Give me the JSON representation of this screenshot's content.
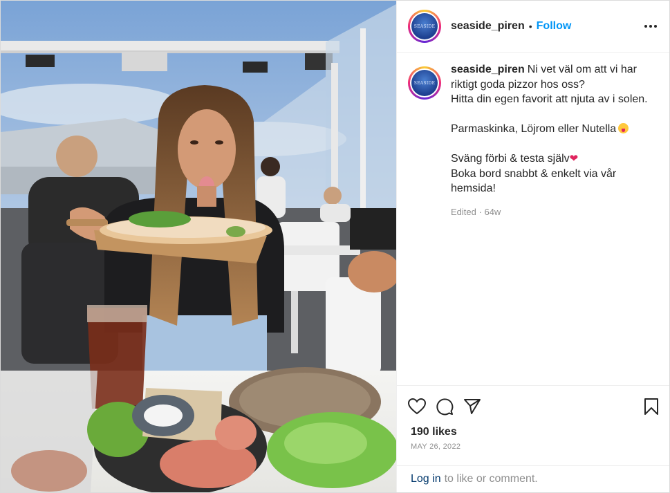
{
  "post": {
    "username": "seaside_piren",
    "avatar_text": "SEASIDE",
    "follow_label": "Follow",
    "separator": "•",
    "more_icon": "more-horizontal-icon",
    "caption_lines": [
      "Ni vet väl om att vi har riktigt goda pizzor hos oss?",
      "Hitta din egen favorit att njuta av i solen.",
      "",
      "Parmaskinka, Löjrom eller Nutella",
      "",
      "Sväng förbi & testa själv",
      "Boka bord snabbt & enkelt via vår hemsida!"
    ],
    "edited_label": "Edited",
    "edited_sep": "·",
    "edited_age": "64w",
    "likes": "190 likes",
    "date": "MAY 26, 2022",
    "login_link": "Log in",
    "login_rest": "to like or comment.",
    "icons": [
      "heart-icon",
      "comment-icon",
      "share-icon",
      "bookmark-icon"
    ],
    "colors": {
      "link": "#0095f6",
      "login": "#00376b",
      "muted": "#8e8e8e"
    }
  }
}
